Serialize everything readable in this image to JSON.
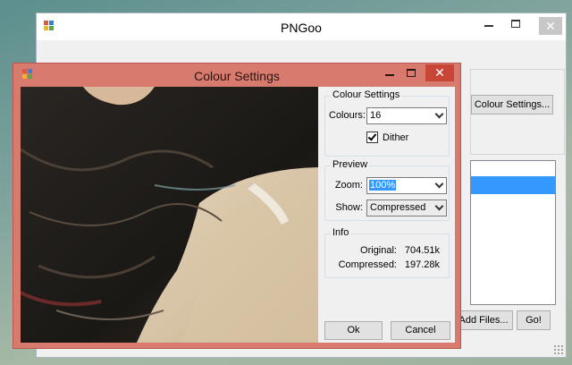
{
  "main_window": {
    "title": "PNGoo",
    "colour_settings_button": "Colour Settings...",
    "add_files_button": "Add Files...",
    "go_button": "Go!"
  },
  "dialog": {
    "title": "Colour Settings",
    "colour_group": {
      "label": "Colour Settings",
      "colours_label": "Colours:",
      "colours_value": "16",
      "dither_label": "Dither",
      "dither_checked": true
    },
    "preview_group": {
      "label": "Preview",
      "zoom_label": "Zoom:",
      "zoom_value": "100%",
      "show_label": "Show:",
      "show_value": "Compressed"
    },
    "info_group": {
      "label": "Info",
      "original_label": "Original:",
      "original_value": "704.51k",
      "compressed_label": "Compressed:",
      "compressed_value": "197.28k"
    },
    "ok_button": "Ok",
    "cancel_button": "Cancel"
  },
  "colors": {
    "dialog_frame": "#d97a6e",
    "close_button": "#c84638",
    "selection": "#3399ff"
  }
}
